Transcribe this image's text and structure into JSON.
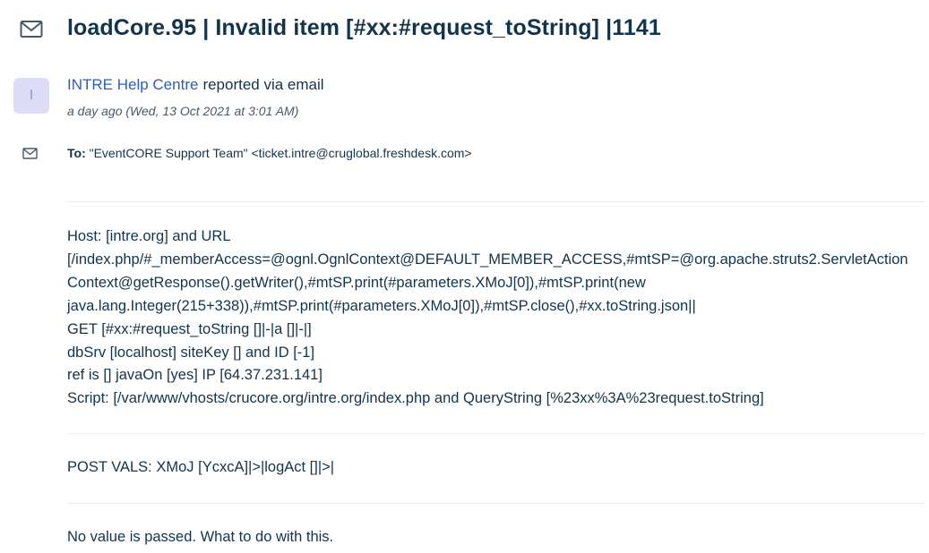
{
  "ticket": {
    "title": "loadCore.95 | Invalid item [#xx:#request_toString] |1141"
  },
  "reporter": {
    "avatar_initial": "I",
    "name": "INTRE Help Centre",
    "via": "reported via email",
    "timestamp": "a day ago (Wed, 13 Oct 2021 at 3:01 AM)"
  },
  "recipient": {
    "label": "To:",
    "value": "\"EventCORE Support Team\" <ticket.intre@cruglobal.freshdesk.com>"
  },
  "message": {
    "lines": [
      "Host: [intre.org] and URL",
      "[/index.php/#_memberAccess=@ognl.OgnlContext@DEFAULT_MEMBER_ACCESS,#mtSP=@org.apache.struts2.ServletAction",
      "Context@getResponse().getWriter(),#mtSP.print(#parameters.XMoJ[0]),#mtSP.print(new",
      "java.lang.Integer(215+338)),#mtSP.print(#parameters.XMoJ[0]),#mtSP.close(),#xx.toString.json||",
      "GET [#xx:#request_toString []|-|a []|-|]",
      "dbSrv [localhost] siteKey [] and ID [-1]",
      "ref is [] javaOn [yes] IP [64.37.231.141]",
      "Script: [/var/www/vhosts/crucore.org/intre.org/index.php and QueryString [%23xx%3A%23request.toString]"
    ],
    "post_vals": "POST VALS: XMoJ [YcxcA]|>|logAct []|>|",
    "note": "No value is passed. What to do with this."
  },
  "colors": {
    "title": "#12344d",
    "link": "#2c5cc5",
    "avatar_bg": "#dcdcf8",
    "divider": "#e7eaee",
    "icon": "#475867"
  },
  "icons": {
    "title": "envelope-icon",
    "recipient": "envelope-icon"
  }
}
